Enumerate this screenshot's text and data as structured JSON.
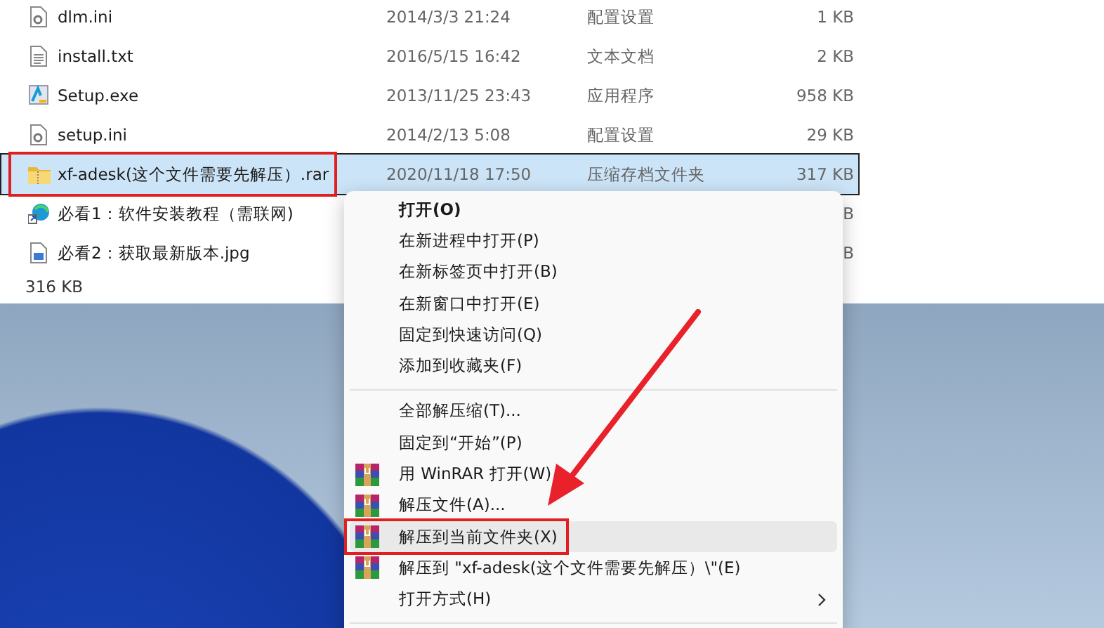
{
  "files": [
    {
      "name": "dlm.ini",
      "kind": "settings",
      "date": "2014/3/3 21:24",
      "type": "配置设置",
      "size": "1 KB",
      "selected": false,
      "annotated": false
    },
    {
      "name": "install.txt",
      "kind": "text",
      "date": "2016/5/15 16:42",
      "type": "文本文档",
      "size": "2 KB",
      "selected": false,
      "annotated": false
    },
    {
      "name": "Setup.exe",
      "kind": "app",
      "date": "2013/11/25 23:43",
      "type": "应用程序",
      "size": "958 KB",
      "selected": false,
      "annotated": false
    },
    {
      "name": "setup.ini",
      "kind": "settings",
      "date": "2014/2/13 5:08",
      "type": "配置设置",
      "size": "29 KB",
      "selected": false,
      "annotated": false
    },
    {
      "name": "xf-adesk(这个文件需要先解压）.rar",
      "kind": "archive",
      "date": "2020/11/18 17:50",
      "type": "压缩存档文件夹",
      "size": "317 KB",
      "selected": true,
      "annotated": true
    },
    {
      "name": "必看1：软件安装教程（需联网)",
      "kind": "shortcut",
      "size": "B",
      "selected": false,
      "annotated": false
    },
    {
      "name": "必看2：获取最新版本.jpg",
      "kind": "image",
      "size": "B",
      "selected": false,
      "annotated": false
    }
  ],
  "status_bar": {
    "size": "316 KB"
  },
  "context_menu": {
    "items": [
      {
        "kind": "plain",
        "label": "打开(O)",
        "bold": true,
        "hovered": false,
        "annotated": false,
        "submenu": false
      },
      {
        "kind": "plain",
        "label": "在新进程中打开(P)",
        "bold": false,
        "hovered": false,
        "annotated": false,
        "submenu": false
      },
      {
        "kind": "plain",
        "label": "在新标签页中打开(B)",
        "bold": false,
        "hovered": false,
        "annotated": false,
        "submenu": false
      },
      {
        "kind": "plain",
        "label": "在新窗口中打开(E)",
        "bold": false,
        "hovered": false,
        "annotated": false,
        "submenu": false
      },
      {
        "kind": "plain",
        "label": "固定到快速访问(Q)",
        "bold": false,
        "hovered": false,
        "annotated": false,
        "submenu": false
      },
      {
        "kind": "plain",
        "label": "添加到收藏夹(F)",
        "bold": false,
        "hovered": false,
        "annotated": false,
        "submenu": false
      },
      {
        "kind": "separator"
      },
      {
        "kind": "plain",
        "label": "全部解压缩(T)...",
        "bold": false,
        "hovered": false,
        "annotated": false,
        "submenu": false
      },
      {
        "kind": "plain",
        "label": "固定到“开始”(P)",
        "bold": false,
        "hovered": false,
        "annotated": false,
        "submenu": false
      },
      {
        "kind": "winrar",
        "label": "用 WinRAR 打开(W)",
        "bold": false,
        "hovered": false,
        "annotated": false,
        "submenu": false
      },
      {
        "kind": "winrar",
        "label": "解压文件(A)...",
        "bold": false,
        "hovered": false,
        "annotated": false,
        "submenu": false
      },
      {
        "kind": "winrar",
        "label": "解压到当前文件夹(X)",
        "bold": false,
        "hovered": true,
        "annotated": true,
        "submenu": false
      },
      {
        "kind": "winrar",
        "label": "解压到 \"xf-adesk(这个文件需要先解压）\\\"(E)",
        "bold": false,
        "hovered": false,
        "annotated": false,
        "submenu": false
      },
      {
        "kind": "plain",
        "label": "打开方式(H)",
        "bold": false,
        "hovered": false,
        "annotated": false,
        "submenu": true
      },
      {
        "kind": "separator"
      }
    ]
  },
  "annotation_arrow": true
}
